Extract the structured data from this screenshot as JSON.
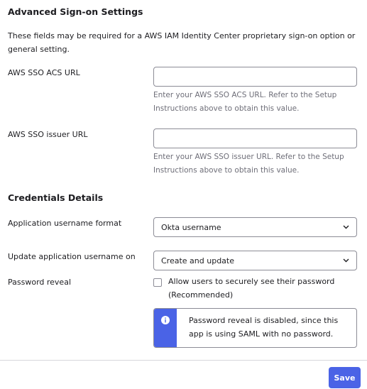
{
  "advanced": {
    "heading": "Advanced Sign-on Settings",
    "intro": "These fields may be required for a AWS IAM Identity Center proprietary sign-on option or general setting.",
    "acs_url": {
      "label": "AWS SSO ACS URL",
      "value": "",
      "help": "Enter your AWS SSO ACS URL. Refer to the Setup Instructions above to obtain this value."
    },
    "issuer_url": {
      "label": "AWS SSO issuer URL",
      "value": "",
      "help": "Enter your AWS SSO issuer URL. Refer to the Setup Instructions above to obtain this value."
    }
  },
  "credentials": {
    "heading": "Credentials Details",
    "username_format": {
      "label": "Application username format",
      "selected": "Okta username"
    },
    "update_on": {
      "label": "Update application username on",
      "selected": "Create and update"
    },
    "password_reveal": {
      "label": "Password reveal",
      "checkbox_label": "Allow users to securely see their password (Recommended)",
      "checked": false,
      "notice": "Password reveal is disabled, since this app is using SAML with no password."
    }
  },
  "footer": {
    "save_label": "Save"
  },
  "colors": {
    "accent": "#4a63e6",
    "border": "#8c8c96",
    "help_text": "#6e6e78"
  },
  "icons": {
    "select_chevron": "chevron-down-icon",
    "callout": "info-icon"
  }
}
